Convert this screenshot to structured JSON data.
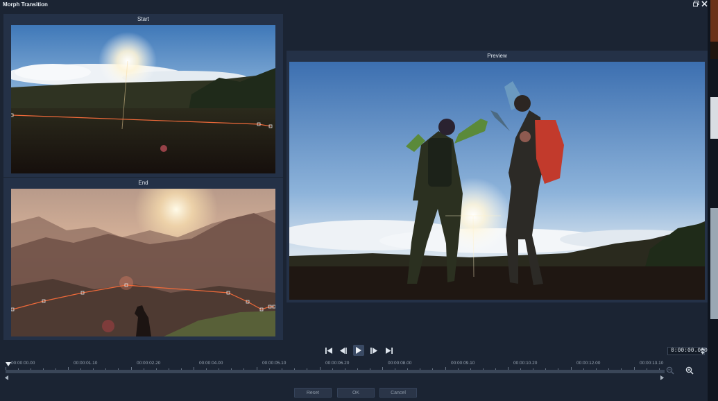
{
  "window": {
    "title": "Morph Transition"
  },
  "panels": {
    "start_label": "Start",
    "end_label": "End",
    "preview_label": "Preview"
  },
  "transport": {
    "timecode": "0:00:00.000"
  },
  "timeline": {
    "labels": [
      "00:00:00.00",
      "00:00:01.10",
      "00:00:02.20",
      "00:00:04.00",
      "00:00:05.10",
      "00:00:06.20",
      "00:00:08.00",
      "00:00:09.10",
      "00:00:10.20",
      "00:00:12.00",
      "00:00:13.10"
    ]
  },
  "footer": {
    "reset_label": "Reset",
    "ok_label": "OK",
    "cancel_label": "Cancel"
  },
  "colors": {
    "background": "#1b2433",
    "panel": "#243147",
    "morph_line": "#f06a3a"
  },
  "icons": [
    "restore-icon",
    "close-icon",
    "go-to-start-icon",
    "previous-frame-icon",
    "play-icon",
    "next-frame-icon",
    "go-to-end-icon",
    "zoom-out-icon",
    "zoom-in-icon",
    "scroll-left-icon",
    "scroll-right-icon"
  ]
}
